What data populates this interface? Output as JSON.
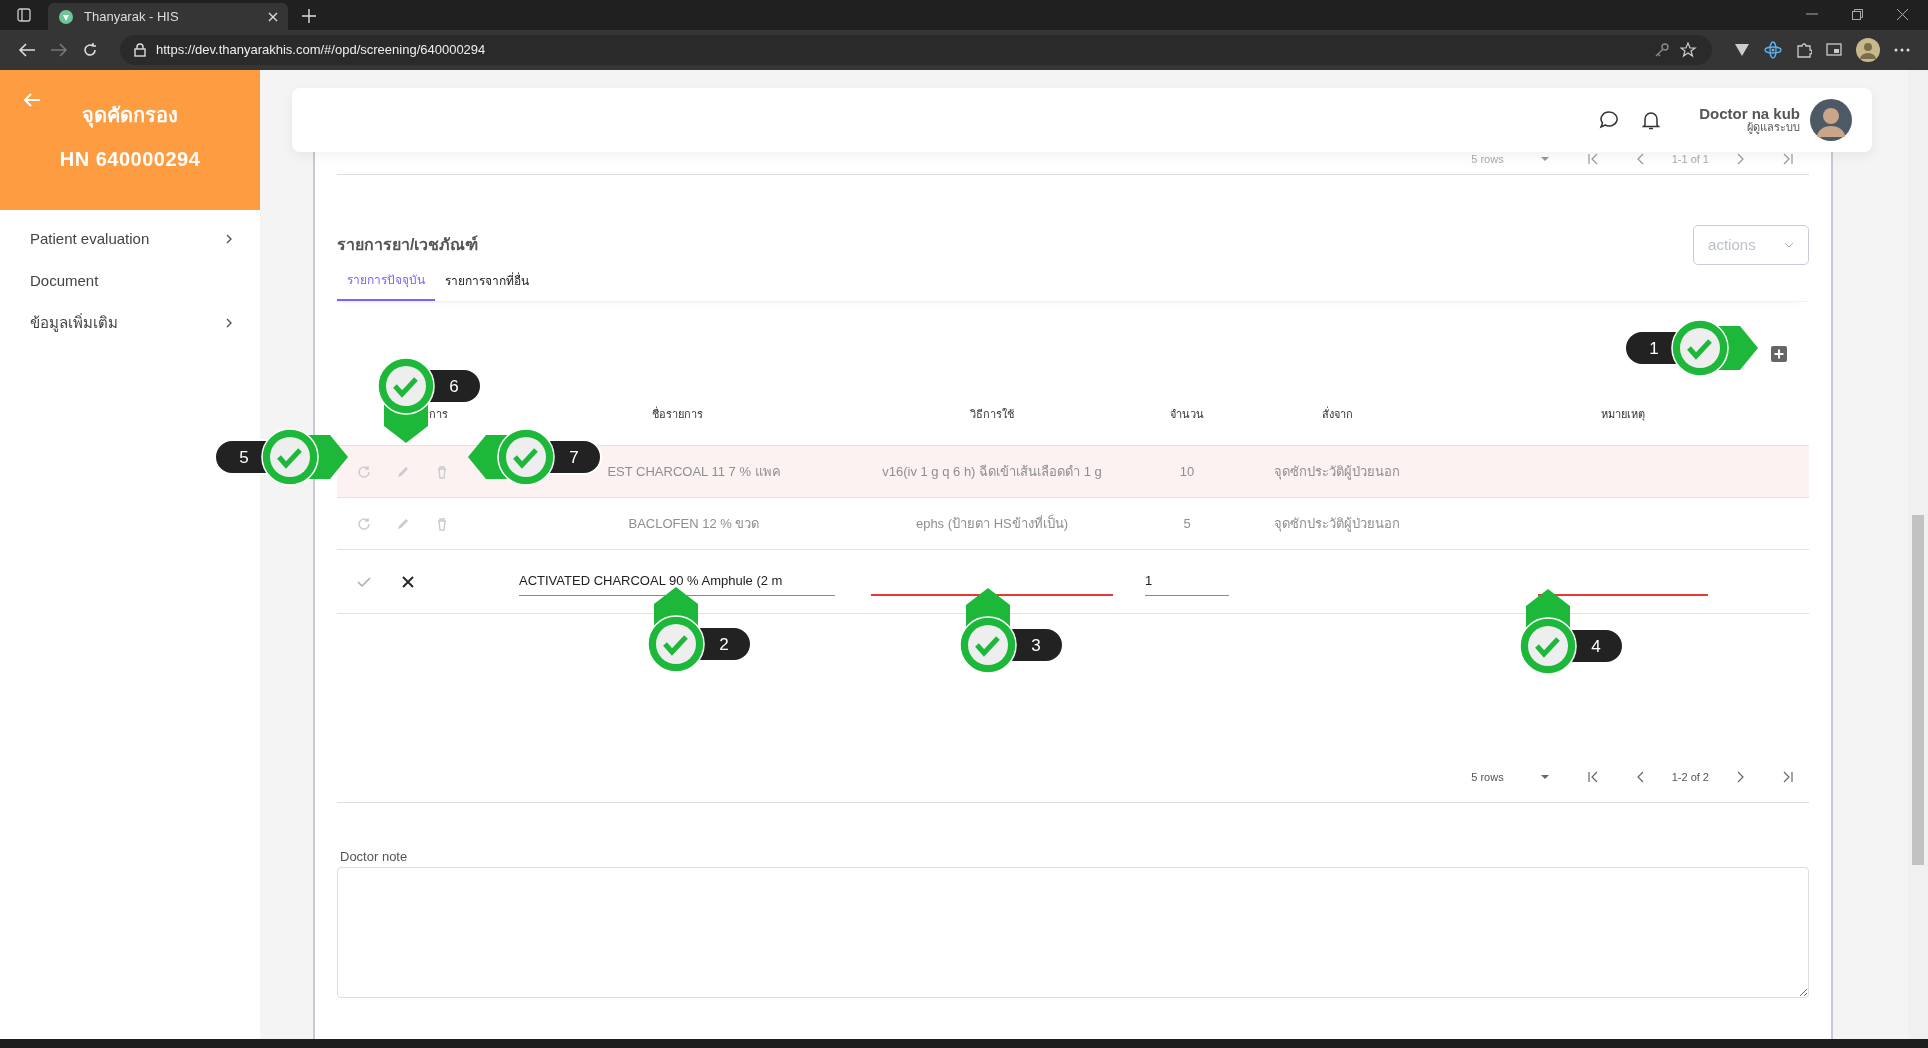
{
  "browser": {
    "tab_title": "Thanyarak - HIS",
    "url": "https://dev.thanyarakhis.com/#/opd/screening/640000294"
  },
  "sidebar": {
    "title": "จุดคัดกรอง",
    "hn": "HN 640000294",
    "items": [
      {
        "label": "Patient evaluation",
        "has_children": true
      },
      {
        "label": "Document",
        "has_children": false
      },
      {
        "label": "ข้อมูลเพิ่มเติม",
        "has_children": true
      }
    ]
  },
  "header": {
    "user_name": "Doctor na kub",
    "user_role": "ผู้ดูแลระบบ"
  },
  "top_pager": {
    "rows": "5 rows",
    "range": "1-1 of 1"
  },
  "section": {
    "title": "รายการยา/เวชภัณฑ์",
    "actions": "actions",
    "tabs": [
      {
        "label": "รายการปัจจุบัน",
        "selected": true
      },
      {
        "label": "รายการจากที่อื่น",
        "selected": false
      }
    ]
  },
  "table": {
    "columns": [
      "การ",
      "ชื่อรายการ",
      "วิธีการใช้",
      "จำนวน",
      "สั่งจาก",
      "หมายเหตุ"
    ],
    "rows": [
      {
        "name": "EST CHARCOAL 11 7 % แพค",
        "usage": "v16(iv 1 g q 6 h) ฉีดเข้าเส้นเลือดดำ 1 g",
        "quantity": "10",
        "ordered_from": "จุดซักประวัติผู้ป่วยนอก",
        "highlighted": true
      },
      {
        "name": "BACLOFEN 12 % ขวด",
        "usage": "ephs (ป้ายตา HSข้างที่เป็น)",
        "quantity": "5",
        "ordered_from": "จุดซักประวัติผู้ป่วยนอก",
        "highlighted": false
      }
    ],
    "edit_row": {
      "name": "ACTIVATED CHARCOAL 90 % Amphule (2 m",
      "usage_invalid": true,
      "quantity": "1",
      "note_invalid": true
    }
  },
  "bottom_pager": {
    "rows": "5 rows",
    "range": "1-2 of 2"
  },
  "doctor_note": {
    "label": "Doctor note"
  },
  "callouts": [
    {
      "number": "1"
    },
    {
      "number": "2"
    },
    {
      "number": "3"
    },
    {
      "number": "4"
    },
    {
      "number": "5"
    },
    {
      "number": "6"
    },
    {
      "number": "7"
    }
  ]
}
